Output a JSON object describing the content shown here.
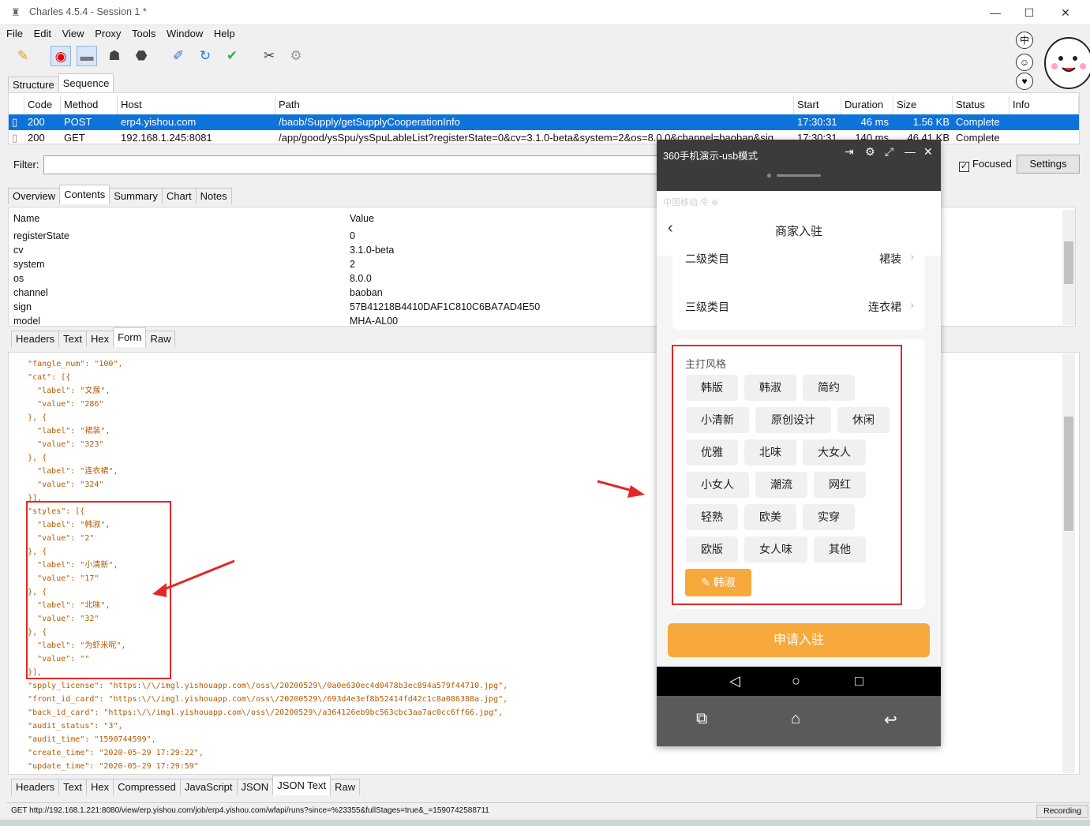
{
  "window": {
    "title": "Charles 4.5.4 - Session 1 *",
    "minimize": "—",
    "maximize": "☐",
    "close": "✕"
  },
  "menu": [
    "File",
    "Edit",
    "View",
    "Proxy",
    "Tools",
    "Window",
    "Help"
  ],
  "top_tabs": [
    "Structure",
    "Sequence"
  ],
  "table": {
    "headers": [
      "Code",
      "Method",
      "Host",
      "Path",
      "Start",
      "Duration",
      "Size",
      "Status",
      "Info"
    ],
    "rows": [
      {
        "code": "200",
        "method": "POST",
        "host": "erp4.yishou.com",
        "path": "/baob/Supply/getSupplyCooperationInfo",
        "start": "17:30:31",
        "duration": "46 ms",
        "size": "1.56 KB",
        "status": "Complete",
        "info": ""
      },
      {
        "code": "200",
        "method": "GET",
        "host": "192.168.1.245:8081",
        "path": "/app/good/ysSpu/ysSpuLableList?registerState=0&cv=3.1.0-beta&system=2&os=8.0.0&channel=baoban&sig...",
        "start": "17:30:31",
        "duration": "140 ms",
        "size": "46.41 KB",
        "status": "Complete",
        "info": ""
      }
    ]
  },
  "filter": {
    "label": "Filter:",
    "value": "",
    "focused_label": "Focused",
    "settings_label": "Settings"
  },
  "detail_tabs": [
    "Overview",
    "Contents",
    "Summary",
    "Chart",
    "Notes"
  ],
  "params": {
    "headers": {
      "name": "Name",
      "value": "Value"
    },
    "rows": [
      {
        "name": "registerState",
        "value": "0"
      },
      {
        "name": "cv",
        "value": "3.1.0-beta"
      },
      {
        "name": "system",
        "value": "2"
      },
      {
        "name": "os",
        "value": "8.0.0"
      },
      {
        "name": "channel",
        "value": "baoban"
      },
      {
        "name": "sign",
        "value": "57B41218B4410DAF1C810C6BA7AD4E50"
      },
      {
        "name": "model",
        "value": "MHA-AL00"
      }
    ]
  },
  "request_tabs": [
    "Headers",
    "Text",
    "Hex",
    "Form",
    "Raw"
  ],
  "json_lines": [
    "    \"fangle_num\": \"100\",",
    "    \"cat\": [{",
    "      \"label\": \"文蔟\",",
    "      \"value\": \"286\"",
    "    }, {",
    "      \"label\": \"裙装\",",
    "      \"value\": \"323\"",
    "    }, {",
    "      \"label\": \"连衣裙\",",
    "      \"value\": \"324\"",
    "    }],",
    "    \"styles\": [{",
    "      \"label\": \"韩淑\",",
    "      \"value\": \"2\"",
    "    }, {",
    "      \"label\": \"小清新\",",
    "      \"value\": \"17\"",
    "    }, {",
    "      \"label\": \"北味\",",
    "      \"value\": \"32\"",
    "    }, {",
    "      \"label\": \"为虾米呢\",",
    "      \"value\": \"\"",
    "    }],",
    "    \"spply_license\": \"https:\\/\\/imgl.yishouapp.com\\/oss\\/20200529\\/0a0e630ec4d0478b3ec894a579f44710.jpg\",",
    "    \"front_id_card\": \"https:\\/\\/imgl.yishouapp.com\\/oss\\/20200529\\/693d4e3ef8b52414fd42c1c8a086388a.jpg\",",
    "    \"back_id_card\": \"https:\\/\\/imgl.yishouapp.com\\/oss\\/20200529\\/a364126eb9bc563cbc3aa7ac0cc6ff66.jpg\",",
    "    \"audit_status\": \"3\",",
    "    \"audit_time\": \"1590744599\",",
    "    \"create_time\": \"2020-05-29 17:29:22\",",
    "    \"update_time\": \"2020-05-29 17:29:59\""
  ],
  "response_tabs": [
    "Headers",
    "Text",
    "Hex",
    "Compressed",
    "JavaScript",
    "JSON",
    "JSON Text",
    "Raw"
  ],
  "status": {
    "url": "GET http://192.168.1.221:8080/view/erp.yishou.com/job/erp4.yishou.com/wfapi/runs?since=%23355&fullStages=true&_=1590742588711",
    "recording": "Recording"
  },
  "side_icons": [
    "中",
    "☺",
    "♥"
  ],
  "phone": {
    "window_title": "360手机演示-usb模式",
    "statusbar_text": "中国移动 令 ⊕  ",
    "page_title": "商家入驻",
    "rows": [
      {
        "label": "二级类目",
        "value": "裙装"
      },
      {
        "label": "三级类目",
        "value": "连衣裙"
      }
    ],
    "section_title": "主打风格",
    "tags": [
      "韩版",
      "韩淑",
      "简约",
      "小清新",
      "原创设计",
      "休闲",
      "优雅",
      "北味",
      "大女人",
      "小女人",
      "潮流",
      "网红",
      "轻熟",
      "欧美",
      "实穿",
      "欧版",
      "女人味",
      "其他"
    ],
    "selected_tag": "韩淑",
    "apply_button": "申请入驻"
  },
  "colors": {
    "accent": "#0e73d9",
    "orange": "#f7a93c",
    "red_box": "#e32626"
  }
}
